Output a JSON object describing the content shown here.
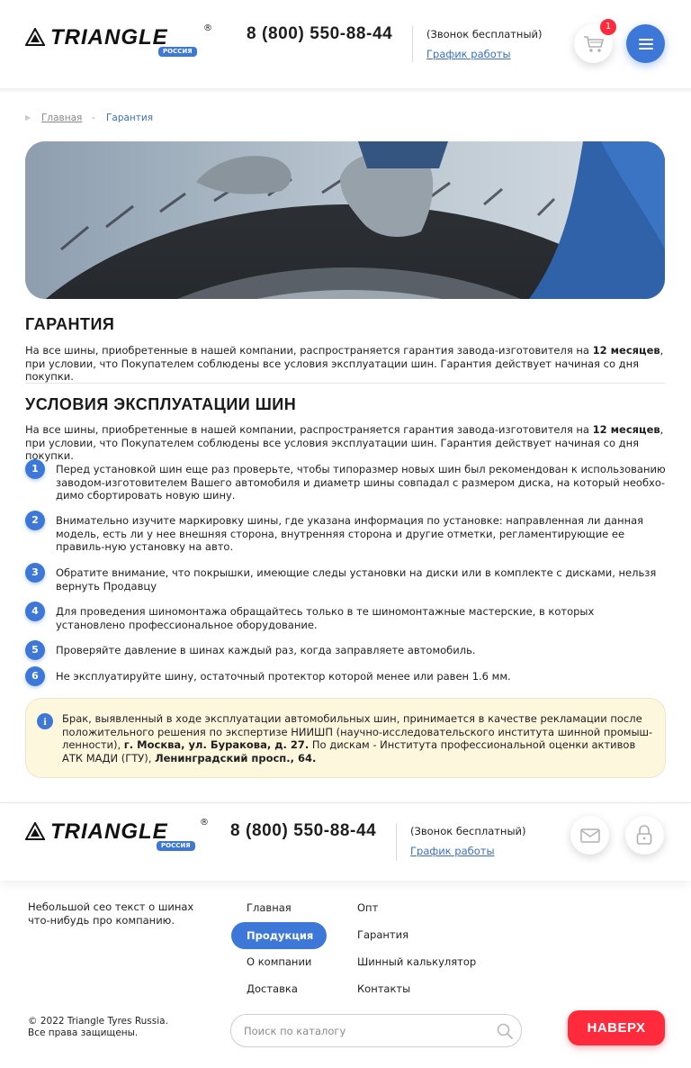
{
  "header": {
    "logo_text": "TRIANGLE",
    "logo_region": "РОССИЯ",
    "logo_reg": "®",
    "phone": "8 (800) 550-88-44",
    "free_call": "(Звонок бесплатный)",
    "schedule_link": "График работы",
    "cart_count": "1",
    "icons": {
      "cart": "cart-icon",
      "menu": "hamburger-menu-icon"
    }
  },
  "breadcrumbs": {
    "home": "Главная",
    "separator": "-",
    "current": "Гарантия"
  },
  "hero": {
    "image": "hands-holding-tire-photo"
  },
  "warranty": {
    "title": "ГАРАНТИЯ",
    "text_before": "На все шины, приобретенные в нашей компании, распространяется гарантия завода-изготовителя на ",
    "text_bold": "12 месяцев",
    "text_after": ", при условии, что Покупателем соблюдены все условия эксплуатации шин. Гарантия действует начиная со дня покупки."
  },
  "conditions": {
    "title": "УСЛОВИЯ ЭКСПЛУАТАЦИИ ШИН",
    "text_before": "На все шины, приобретенные в нашей компании, распространяется гарантия завода-изготовителя на ",
    "text_bold": "12 месяцев",
    "text_after": ", при условии, что Покупателем соблюдены все условия эксплуатации шин. Гарантия действует начиная со дня покупки.",
    "items": [
      {
        "num": "1",
        "text": "Перед установкой шин еще раз проверьте, чтобы типоразмер новых шин был рекомендован к использованию заводом-изготовителем Вашего автомобиля и диаметр шины совпадал с размером диска, на который необхо-димо сбортировать новую шину."
      },
      {
        "num": "2",
        "text": "Внимательно изучите маркировку шины, где указана информация по установке: направленная ли данная модель, есть ли у нее внешняя сторона, внутренняя сторона и другие отметки, регламентирующие ее правиль-ную установку на авто."
      },
      {
        "num": "3",
        "text": "Обратите внимание, что покрышки, имеющие следы установки на диски или в комплекте с дисками, нельзя вернуть Продавцу"
      },
      {
        "num": "4",
        "text": "Для проведения шиномонтажа обращайтесь только в те шиномонтажные мастерские, в которых установлено профессиональное оборудование."
      },
      {
        "num": "5",
        "text": "Проверяйте давление в шинах каждый раз, когда заправляете автомобиль."
      },
      {
        "num": "6",
        "text": "Не эксплуатируйте шину, остаточный протектор которой менее или равен 1.6 мм."
      }
    ]
  },
  "notice": {
    "icon": "info-icon",
    "icon_glyph": "i",
    "text_1": "Брак, выявленный в ходе эксплуатации автомобильных шин, принимается в качестве рекламации после положительного решения по экспертизе НИИШП (научно-исследовательского института шинной промыш-ленности), ",
    "bold_1": "г. Москва, ул. Буракова, д. 27.",
    "text_2": " По дискам - Института профессиональной оценки активов АТК МАДИ (ГТУ), ",
    "bold_2": "Ленинградский просп., 64."
  },
  "footer": {
    "logo_text": "TRIANGLE",
    "logo_region": "РОССИЯ",
    "logo_reg": "®",
    "phone": "8 (800) 550-88-44",
    "free_call": "(Звонок бесплатный)",
    "schedule_link": "График работы",
    "icons": {
      "mail": "mail-icon",
      "lock": "lock-icon"
    },
    "seo_text": "Небольшой сео текст о шинах что-нибудь про компанию.",
    "nav_col1": [
      "Главная",
      "Продукция",
      "О компании",
      "Доставка"
    ],
    "nav_col2": [
      "Опт",
      "Гарантия",
      "Шинный калькулятор",
      "Контакты"
    ],
    "active_nav": "Продукция",
    "copyright_1": "© 2022 Triangle Tyres Russia.",
    "copyright_2": "Все права защищены.",
    "search_placeholder": "Поиск по каталогу",
    "up_button": "НАВЕРХ"
  },
  "colors": {
    "accent": "#3d78d8",
    "red": "#ff2b3d",
    "notice_bg": "#fdf7dd"
  }
}
